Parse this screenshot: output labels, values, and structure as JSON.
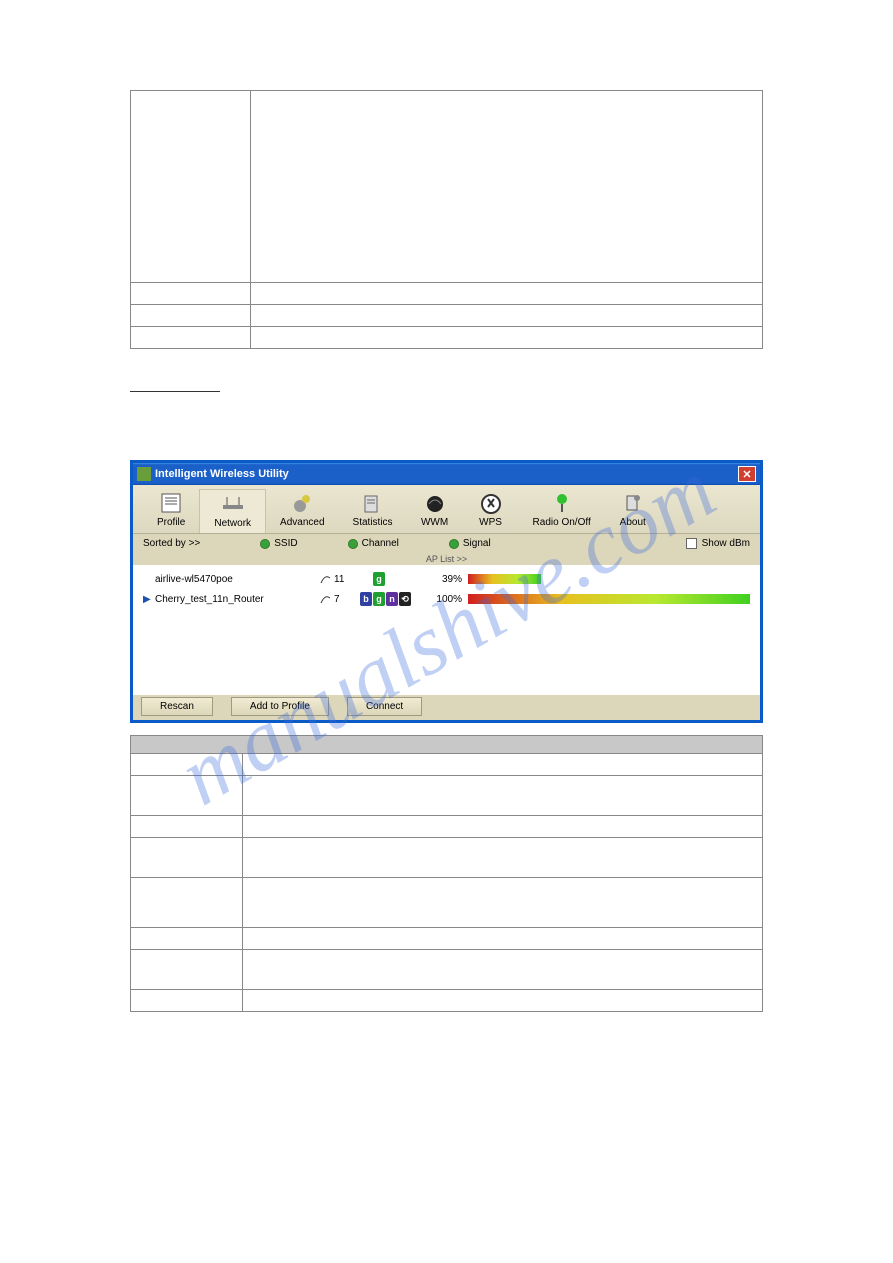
{
  "top_table_rows": 4,
  "section_label": " ",
  "window": {
    "title": "Intelligent Wireless Utility",
    "toolbar": [
      {
        "name": "profile",
        "label": "Profile"
      },
      {
        "name": "network",
        "label": "Network"
      },
      {
        "name": "advanced",
        "label": "Advanced"
      },
      {
        "name": "statistics",
        "label": "Statistics"
      },
      {
        "name": "wwm",
        "label": "WWM"
      },
      {
        "name": "wps",
        "label": "WPS"
      },
      {
        "name": "radio",
        "label": "Radio On/Off"
      },
      {
        "name": "about",
        "label": "About"
      }
    ],
    "active_tab": "Network",
    "sort": {
      "label": "Sorted by >>",
      "options": [
        "SSID",
        "Channel",
        "Signal"
      ],
      "show_dbm": "Show dBm",
      "ap_list_label": "AP List >>"
    },
    "ap_list": [
      {
        "selected": false,
        "ssid": "airlive-wl5470poe",
        "channel": "11",
        "modes": [
          "g"
        ],
        "pct": "39%",
        "signal_width": 26
      },
      {
        "selected": true,
        "ssid": "Cherry_test_11n_Router",
        "channel": "7",
        "modes": [
          "b",
          "g",
          "n",
          "w"
        ],
        "pct": "100%",
        "signal_width": 100
      }
    ],
    "buttons": {
      "rescan": "Rescan",
      "add_profile": "Add to Profile",
      "connect": "Connect"
    }
  },
  "bottom_table_rows": 10,
  "watermark": "manualshive.com"
}
